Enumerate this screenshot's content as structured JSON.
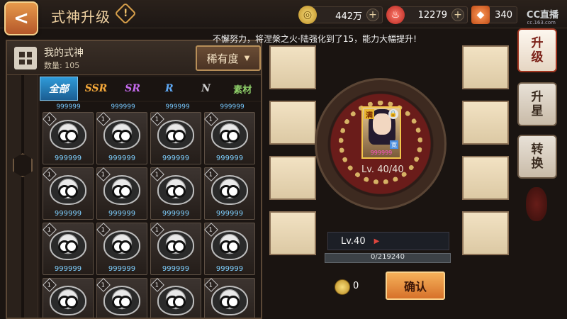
{
  "header": {
    "back_label": "<",
    "title": "式神升级",
    "help_label": "!",
    "resources": [
      {
        "name": "coin",
        "icon": "coin-icon",
        "value": "442万"
      },
      {
        "name": "stamina",
        "icon": "stamina-icon",
        "value": "12279"
      },
      {
        "name": "jade",
        "icon": "jade-icon",
        "value": "340"
      }
    ],
    "plus_label": "+",
    "watermark": "CC直播",
    "watermark_sub": "cc.163.com"
  },
  "shiki_panel": {
    "title": "我的式神",
    "count": "数量: 105",
    "rarity_label": "稀有度",
    "tabs": [
      "全部",
      "SSR",
      "SR",
      "R",
      "N",
      "素材"
    ],
    "active_tab": 0,
    "partial_row_stars": [
      "999999",
      "999999",
      "999999",
      "999999"
    ],
    "cards": [
      {
        "level": "1",
        "stars": "999999"
      },
      {
        "level": "1",
        "stars": "999999"
      },
      {
        "level": "1",
        "stars": "999999"
      },
      {
        "level": "1",
        "stars": "999999"
      },
      {
        "level": "1",
        "stars": "999999"
      },
      {
        "level": "1",
        "stars": "999999"
      },
      {
        "level": "1",
        "stars": "999999"
      },
      {
        "level": "1",
        "stars": "999999"
      },
      {
        "level": "1",
        "stars": "999999"
      },
      {
        "level": "1",
        "stars": "999999"
      },
      {
        "level": "1",
        "stars": "999999"
      },
      {
        "level": "1",
        "stars": "999999"
      },
      {
        "level": "1",
        "stars": ""
      },
      {
        "level": "1",
        "stars": ""
      },
      {
        "level": "1",
        "stars": ""
      },
      {
        "level": "1",
        "stars": ""
      }
    ]
  },
  "upgrade": {
    "notice": "不懈努力，将涅槃之火·陆强化到了15，能力大幅提升!",
    "portrait_max": "满",
    "portrait_stars": "999999",
    "portrait_role": "寛",
    "level_display": "Lv. 40/40",
    "level_target": "Lv.40",
    "exp_text": "0/219240",
    "exp_fraction": 0.0,
    "cost": "0",
    "confirm_label": "确认"
  },
  "side_nav": [
    {
      "label": "升级",
      "active": true
    },
    {
      "label": "升星",
      "active": false
    },
    {
      "label": "转换",
      "active": false
    }
  ]
}
